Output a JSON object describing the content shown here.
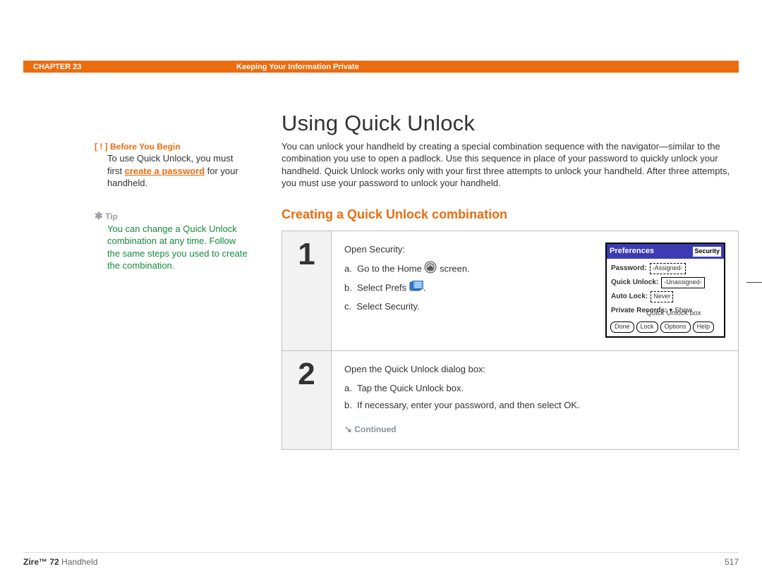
{
  "header": {
    "chapter": "CHAPTER 23",
    "title": "Keeping Your Information Private"
  },
  "sidebar": {
    "before_bracket": "[ ! ]",
    "before_label": "Before You Begin",
    "before_text_pre": "To use Quick Unlock, you must first ",
    "before_link": "create a password",
    "before_text_post": " for your handheld.",
    "tip_star": "✱",
    "tip_label": "Tip",
    "tip_text": "You can change a Quick Unlock combination at any time. Follow the same steps you used to create the combination."
  },
  "main": {
    "h1": "Using Quick Unlock",
    "intro": "You can unlock your handheld by creating a special combination sequence with the navigator—similar to the combination you use to open a padlock. Use this sequence in place of your password to quickly unlock your handheld. Quick Unlock works only with your first three attempts to unlock your handheld. After three attempts, you must use your password to unlock your handheld.",
    "h2": "Creating a Quick Unlock combination",
    "steps": [
      {
        "num": "1",
        "lead": "Open Security:",
        "items": [
          {
            "pre": "Go to the Home ",
            "icon": "home-icon",
            "post": " screen."
          },
          {
            "pre": "Select Prefs ",
            "icon": "prefs-icon",
            "post": "."
          },
          {
            "pre": "Select Security.",
            "icon": null,
            "post": ""
          }
        ]
      },
      {
        "num": "2",
        "lead": "Open the Quick Unlock dialog box:",
        "items": [
          {
            "pre": "Tap the Quick Unlock box.",
            "icon": null,
            "post": ""
          },
          {
            "pre": "If necessary, enter your password, and then select OK.",
            "icon": null,
            "post": ""
          }
        ]
      }
    ],
    "continued": "Continued"
  },
  "screenshot": {
    "title": "Preferences",
    "category": "Security",
    "rows": {
      "password_label": "Password:",
      "password_value": "-Assigned-",
      "quick_label": "Quick Unlock:",
      "quick_value": "-Unassigned-",
      "auto_label": "Auto Lock:",
      "auto_value": "Never"
    },
    "private_label": "Private Records:",
    "private_value": "Show",
    "buttons": [
      "Done",
      "Lock",
      "Options",
      "Help"
    ],
    "callout": "Quick Unlock box"
  },
  "footer": {
    "product_bold": "Zire™ 72",
    "product_rest": " Handheld",
    "page": "517"
  }
}
